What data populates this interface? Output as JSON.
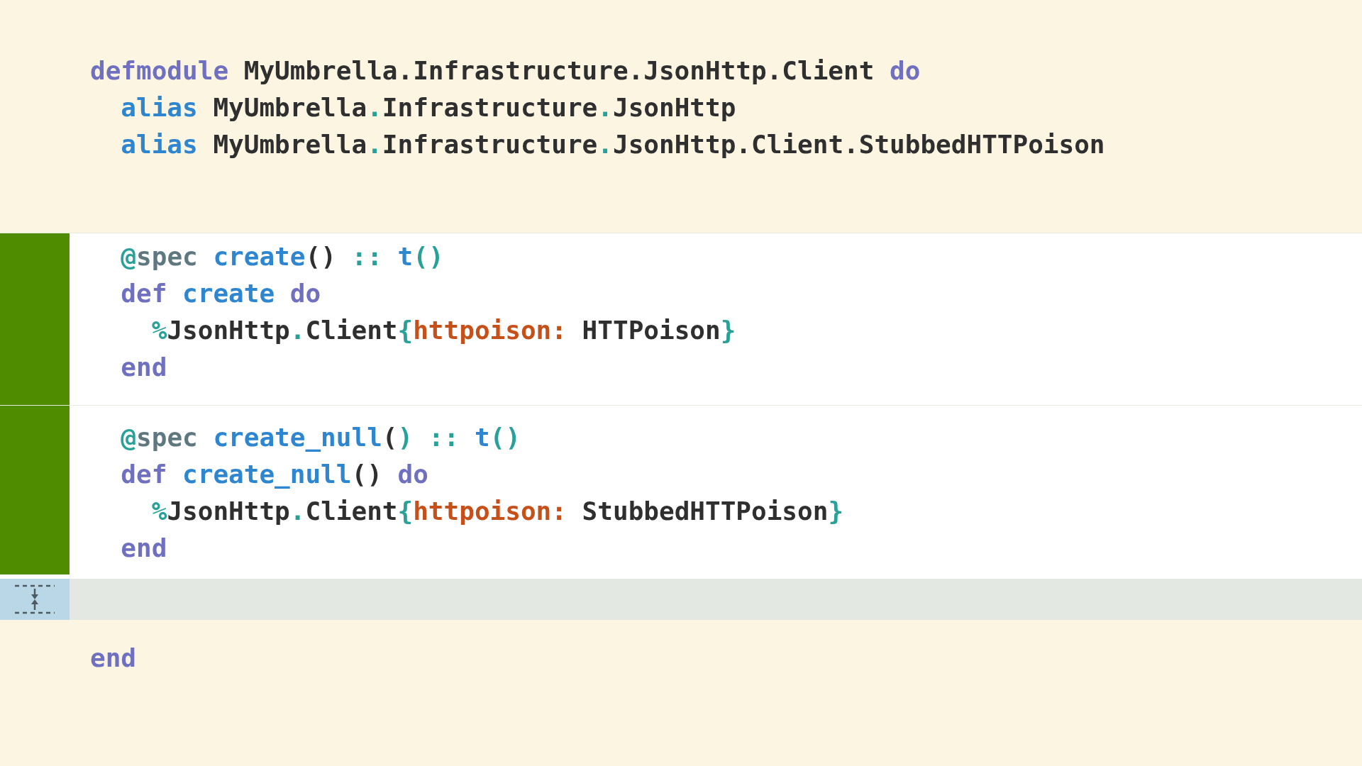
{
  "sections": [
    {
      "kind": "context",
      "lines": [
        [
          {
            "t": "defmodule ",
            "kind": "kw"
          },
          {
            "t": "MyUmbrella.Infrastructure.JsonHttp.Client ",
            "kind": "name"
          },
          {
            "t": "do",
            "kind": "kw"
          }
        ],
        [
          {
            "t": "  alias ",
            "kind": "fn"
          },
          {
            "t": "MyUmbrella",
            "kind": "name"
          },
          {
            "t": ".",
            "kind": "punct"
          },
          {
            "t": "Infrastructure",
            "kind": "name"
          },
          {
            "t": ".",
            "kind": "punct"
          },
          {
            "t": "JsonHttp",
            "kind": "name"
          }
        ],
        [
          {
            "t": "  alias ",
            "kind": "fn"
          },
          {
            "t": "MyUmbrella",
            "kind": "name"
          },
          {
            "t": ".",
            "kind": "punct"
          },
          {
            "t": "Infrastructure",
            "kind": "name"
          },
          {
            "t": ".",
            "kind": "punct"
          },
          {
            "t": "JsonHttp.Client.StubbedHTTPoison",
            "kind": "name"
          }
        ]
      ]
    },
    {
      "kind": "added",
      "lines": [
        [
          {
            "t": "  @",
            "kind": "punct"
          },
          {
            "t": "spec ",
            "kind": "attr"
          },
          {
            "t": "create",
            "kind": "fn"
          },
          {
            "t": "() ",
            "kind": "name"
          },
          {
            "t": ":: ",
            "kind": "punct"
          },
          {
            "t": "t",
            "kind": "fn"
          },
          {
            "t": "()",
            "kind": "punct"
          }
        ],
        [
          {
            "t": "  def ",
            "kind": "kw"
          },
          {
            "t": "create ",
            "kind": "fn"
          },
          {
            "t": "do",
            "kind": "kw"
          }
        ],
        [
          {
            "t": "    %",
            "kind": "punct"
          },
          {
            "t": "JsonHttp",
            "kind": "name"
          },
          {
            "t": ".",
            "kind": "punct"
          },
          {
            "t": "Client",
            "kind": "name"
          },
          {
            "t": "{",
            "kind": "punct"
          },
          {
            "t": "httpoison:",
            "kind": "atom"
          },
          {
            "t": " HTTPoison",
            "kind": "name"
          },
          {
            "t": "}",
            "kind": "punct"
          }
        ],
        [
          {
            "t": "  end",
            "kind": "kw"
          }
        ]
      ]
    },
    {
      "kind": "added",
      "lines": [
        [
          {
            "t": "  @",
            "kind": "punct"
          },
          {
            "t": "spec ",
            "kind": "attr"
          },
          {
            "t": "create_null",
            "kind": "fn"
          },
          {
            "t": "(",
            "kind": "name"
          },
          {
            "t": ") ",
            "kind": "punct"
          },
          {
            "t": ":: ",
            "kind": "punct"
          },
          {
            "t": "t",
            "kind": "fn"
          },
          {
            "t": "()",
            "kind": "punct"
          }
        ],
        [
          {
            "t": "  def ",
            "kind": "kw"
          },
          {
            "t": "create_null",
            "kind": "fn"
          },
          {
            "t": "() ",
            "kind": "name"
          },
          {
            "t": "do",
            "kind": "kw"
          }
        ],
        [
          {
            "t": "    %",
            "kind": "punct"
          },
          {
            "t": "JsonHttp",
            "kind": "name"
          },
          {
            "t": ".",
            "kind": "punct"
          },
          {
            "t": "Client",
            "kind": "name"
          },
          {
            "t": "{",
            "kind": "punct"
          },
          {
            "t": "httpoison:",
            "kind": "atom"
          },
          {
            "t": " StubbedHTTPoison",
            "kind": "name"
          },
          {
            "t": "}",
            "kind": "punct"
          }
        ],
        [
          {
            "t": "  end",
            "kind": "kw"
          }
        ]
      ]
    },
    {
      "kind": "collapsed"
    },
    {
      "kind": "context",
      "lines": [
        [
          {
            "t": "end",
            "kind": "kw"
          }
        ]
      ]
    }
  ]
}
